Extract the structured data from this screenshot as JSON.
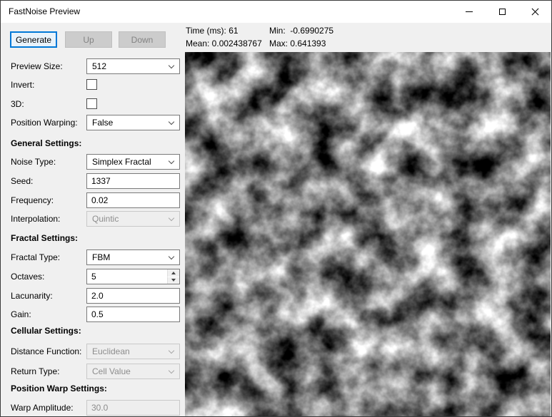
{
  "window": {
    "title": "FastNoise Preview"
  },
  "toolbar": {
    "generate": "Generate",
    "up": "Up",
    "down": "Down"
  },
  "stats": {
    "time": "Time (ms): 61",
    "min": "Min:  -0.6990275",
    "mean": "Mean: 0.002438767",
    "max": "Max: 0.641393"
  },
  "form": {
    "preview_size": {
      "label": "Preview Size:",
      "value": "512"
    },
    "invert": {
      "label": "Invert:",
      "checked": false
    },
    "three_d": {
      "label": "3D:",
      "checked": false
    },
    "position_warping": {
      "label": "Position Warping:",
      "value": "False"
    },
    "general_header": "General Settings:",
    "noise_type": {
      "label": "Noise Type:",
      "value": "Simplex Fractal"
    },
    "seed": {
      "label": "Seed:",
      "value": "1337"
    },
    "frequency": {
      "label": "Frequency:",
      "value": "0.02"
    },
    "interpolation": {
      "label": "Interpolation:",
      "value": "Quintic",
      "enabled": false
    },
    "fractal_header": "Fractal Settings:",
    "fractal_type": {
      "label": "Fractal Type:",
      "value": "FBM"
    },
    "octaves": {
      "label": "Octaves:",
      "value": "5"
    },
    "lacunarity": {
      "label": "Lacunarity:",
      "value": "2.0"
    },
    "gain": {
      "label": "Gain:",
      "value": "0.5"
    },
    "cellular_header": "Cellular Settings:",
    "distance_function": {
      "label": "Distance Function:",
      "value": "Euclidean",
      "enabled": false
    },
    "return_type": {
      "label": "Return Type:",
      "value": "Cell Value",
      "enabled": false
    },
    "warp_header": "Position Warp Settings:",
    "warp_amplitude": {
      "label": "Warp Amplitude:",
      "value": "30.0",
      "enabled": false
    }
  },
  "colors": {
    "accent_focus": "#0078d7",
    "window_bg": "#f0f0f0",
    "titlebar_bg": "#ffffff"
  }
}
